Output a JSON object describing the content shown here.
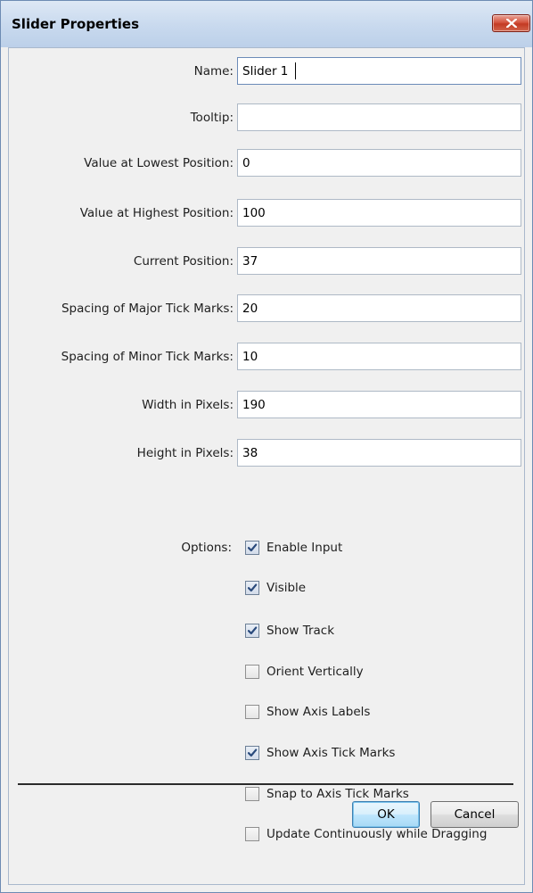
{
  "window": {
    "title": "Slider Properties"
  },
  "fields": [
    {
      "label": "Name:",
      "value": "Slider 1",
      "name": "name"
    },
    {
      "label": "Tooltip:",
      "value": "",
      "name": "tooltip"
    },
    {
      "label": "Value at Lowest Position:",
      "value": "0",
      "name": "value-lowest"
    },
    {
      "label": "Value at Highest Position:",
      "value": "100",
      "name": "value-highest"
    },
    {
      "label": "Current Position:",
      "value": "37",
      "name": "current-position"
    },
    {
      "label": "Spacing of Major Tick Marks:",
      "value": "20",
      "name": "major-tick-spacing"
    },
    {
      "label": "Spacing of Minor Tick Marks:",
      "value": "10",
      "name": "minor-tick-spacing"
    },
    {
      "label": "Width in Pixels:",
      "value": "190",
      "name": "width-pixels"
    },
    {
      "label": "Height in Pixels:",
      "value": "38",
      "name": "height-pixels"
    }
  ],
  "options": {
    "label": "Options:",
    "items": [
      {
        "label": "Enable Input",
        "checked": true
      },
      {
        "label": "Visible",
        "checked": true
      },
      {
        "label": "Show Track",
        "checked": true
      },
      {
        "label": "Orient Vertically",
        "checked": false
      },
      {
        "label": "Show Axis Labels",
        "checked": false
      },
      {
        "label": "Show Axis Tick Marks",
        "checked": true
      },
      {
        "label": "Snap to Axis Tick Marks",
        "checked": false
      },
      {
        "label": "Update Continuously while Dragging",
        "checked": false
      }
    ]
  },
  "buttons": {
    "ok": "OK",
    "cancel": "Cancel"
  }
}
